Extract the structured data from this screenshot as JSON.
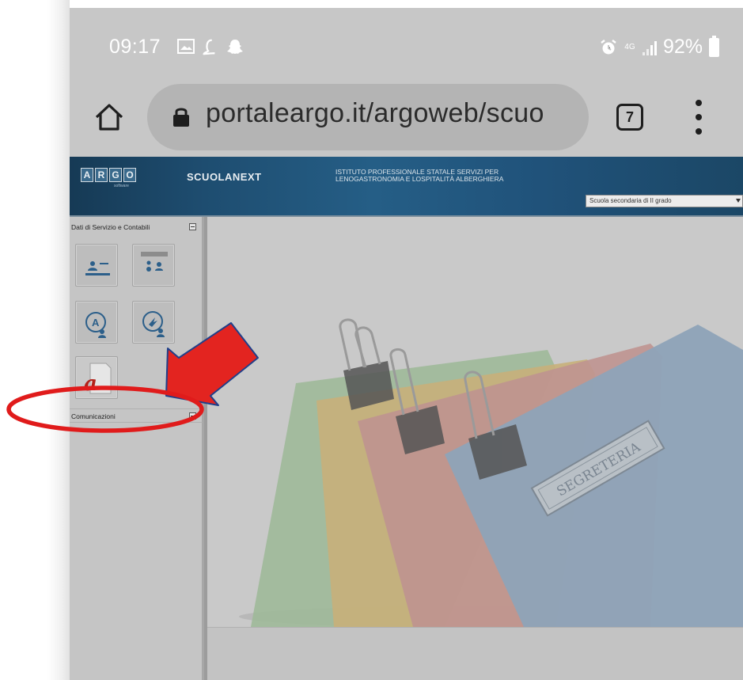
{
  "status_bar": {
    "time": "09:17",
    "network": "4G",
    "battery": "92%",
    "icons": [
      "gallery-icon",
      "l-app-icon",
      "snapchat-icon",
      "alarm-icon",
      "signal-icon",
      "battery-icon"
    ]
  },
  "browser": {
    "url": "portaleargo.it/argoweb/scuo",
    "tab_count": "7",
    "icons": [
      "home-icon",
      "lock-icon",
      "tabs-icon",
      "menu-icon"
    ]
  },
  "app_header": {
    "logo_letters": [
      "A",
      "R",
      "G",
      "O"
    ],
    "logo_sub": "software",
    "product": "SCUOLANEXT",
    "institute_line1": "ISTITUTO PROFESSIONALE STATALE SERVIZI PER",
    "institute_line2": "LENOGASTRONOMIA E LOSPITALITÀ ALBERGHIERA",
    "school_select": "Scuola secondaria di II grado"
  },
  "side_panel": {
    "section1_title": "Dati di Servizio e Contabili",
    "section2_title": "Comunicazioni",
    "tiles": [
      "id-card-icon",
      "user-list-icon",
      "user-a-icon",
      "user-clock-icon",
      "acrobat-icon"
    ]
  },
  "main_image": {
    "label": "SEGRETERIA",
    "folder_colors": [
      "#8fbf8a",
      "#d9b36a",
      "#d08a86",
      "#8aa7c4"
    ]
  },
  "annotation": {
    "arrow_color": "#e32420",
    "ellipse_color": "#e01b1b"
  }
}
